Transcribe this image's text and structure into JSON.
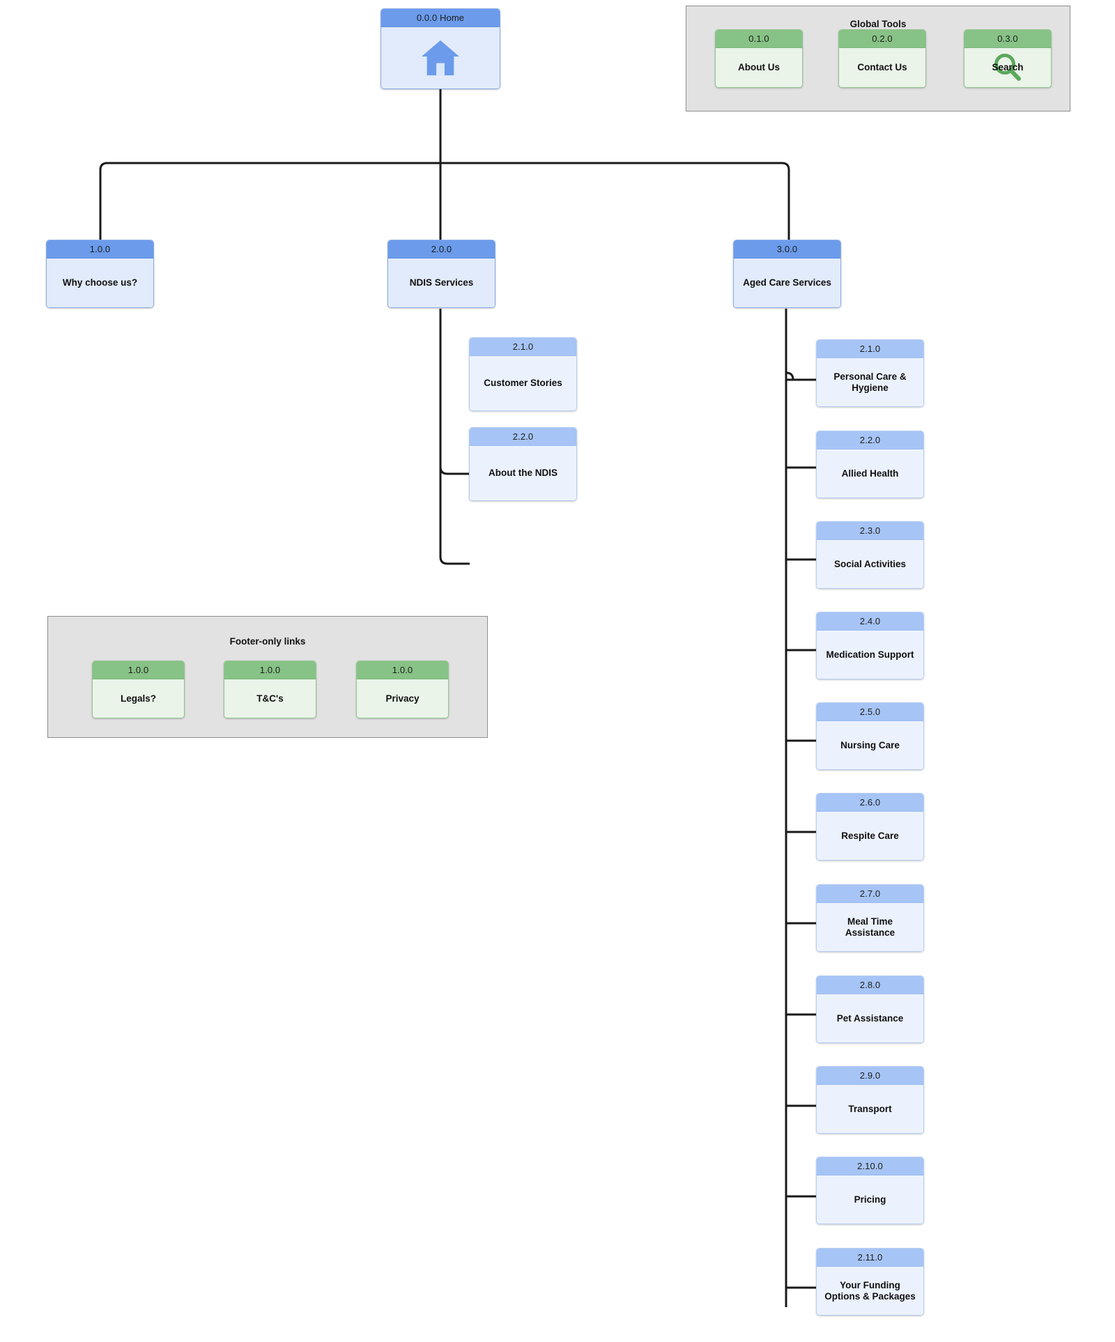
{
  "diagram": {
    "type": "sitemap-tree",
    "root": {
      "id": "0.0.0",
      "label": "Home",
      "header_text": "0.0.0 Home",
      "icon": "home-icon"
    },
    "groups": [
      {
        "key": "global_tools",
        "title": "Global Tools",
        "nodes": [
          {
            "id": "0.1.0",
            "label": "About Us"
          },
          {
            "id": "0.2.0",
            "label": "Contact Us"
          },
          {
            "id": "0.3.0",
            "label": "Search",
            "icon": "search-icon"
          }
        ]
      },
      {
        "key": "footer_links",
        "title": "Footer-only links",
        "nodes": [
          {
            "id": "1.0.0",
            "label": "Legals?"
          },
          {
            "id": "1.0.0",
            "label": "T&C's"
          },
          {
            "id": "1.0.0",
            "label": "Privacy"
          }
        ]
      }
    ],
    "branches": [
      {
        "key": "why_choose_us",
        "id": "1.0.0",
        "label": "Why choose us?",
        "children": []
      },
      {
        "key": "ndis_services",
        "id": "2.0.0",
        "label": "NDIS Services",
        "children": [
          {
            "id": "2.1.0",
            "label": "Customer Stories"
          },
          {
            "id": "2.2.0",
            "label": "About the NDIS"
          }
        ]
      },
      {
        "key": "aged_care_services",
        "id": "3.0.0",
        "label": "Aged Care Services",
        "children": [
          {
            "id": "2.1.0",
            "label": "Personal Care & Hygiene"
          },
          {
            "id": "2.2.0",
            "label": "Allied Health"
          },
          {
            "id": "2.3.0",
            "label": "Social Activities"
          },
          {
            "id": "2.4.0",
            "label": "Medication Support"
          },
          {
            "id": "2.5.0",
            "label": "Nursing Care"
          },
          {
            "id": "2.6.0",
            "label": "Respite Care"
          },
          {
            "id": "2.7.0",
            "label": "Meal Time Assistance"
          },
          {
            "id": "2.8.0",
            "label": "Pet Assistance"
          },
          {
            "id": "2.9.0",
            "label": "Transport"
          },
          {
            "id": "2.10.0",
            "label": "Pricing"
          },
          {
            "id": "2.11.0",
            "label": "Your Funding Options & Packages"
          }
        ]
      }
    ]
  },
  "colors": {
    "level1_header": "#6b9bea",
    "level1_body": "#e2ebfb",
    "level2_header": "#a6c4f5",
    "level2_body": "#ecf2fd",
    "group_header": "#87c286",
    "group_body": "#eaf4e9",
    "panel_fill": "#e2e2e2",
    "connector": "#1a1a1a"
  }
}
